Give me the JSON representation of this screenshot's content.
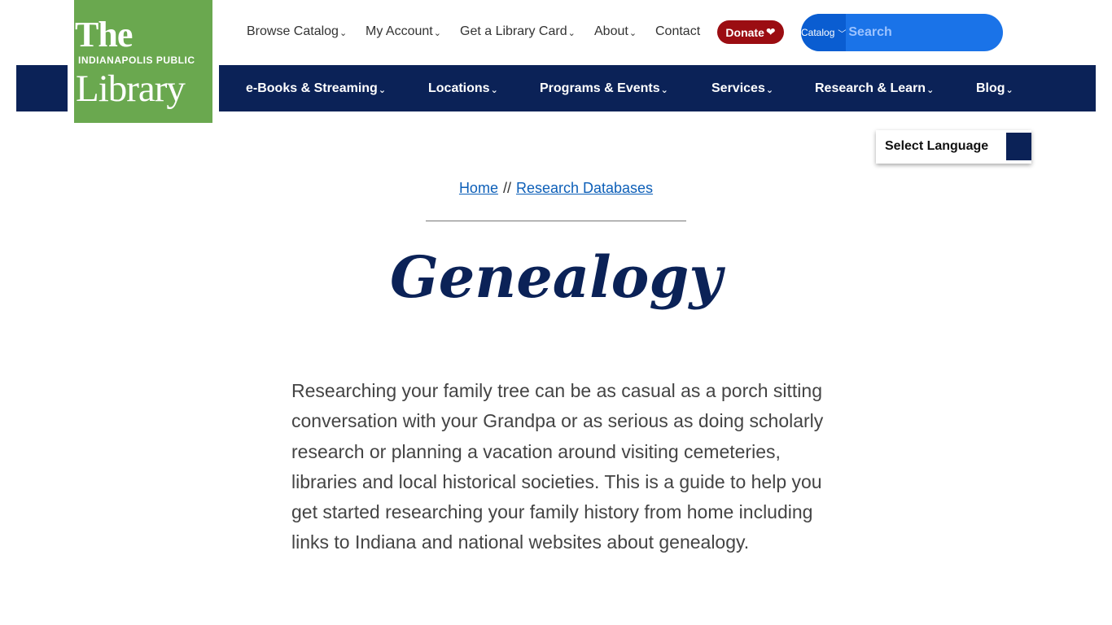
{
  "logo": {
    "line1": "The",
    "line2": "INDIANAPOLIS PUBLIC",
    "line3": "Library",
    "color": "#6aa84f"
  },
  "utility_nav": {
    "items": [
      "Browse Catalog",
      "My Account",
      "Get a Library Card",
      "About",
      "Contact"
    ],
    "donate_label": "Donate",
    "donate_color": "#9b0d12"
  },
  "search": {
    "scope": "Catalog",
    "placeholder": "Search",
    "icon": "search-icon",
    "color": "#1a73e8"
  },
  "main_nav": {
    "color": "#0b2257",
    "items": [
      "e-Books & Streaming",
      "Locations",
      "Programs & Events",
      "Services",
      "Research & Learn",
      "Blog"
    ]
  },
  "language": {
    "label": "Select Language"
  },
  "breadcrumb": {
    "home": "Home",
    "separator": "//",
    "current": "Research Databases"
  },
  "page": {
    "title": "Genealogy",
    "intro": "Researching your family tree can be as casual as a porch sitting conversation with your Grandpa or as serious as doing scholarly research or planning a vacation around visiting cemeteries, libraries and local historical societies. This is a guide to help you get started researching your family history from home including links to Indiana and national websites about genealogy."
  }
}
